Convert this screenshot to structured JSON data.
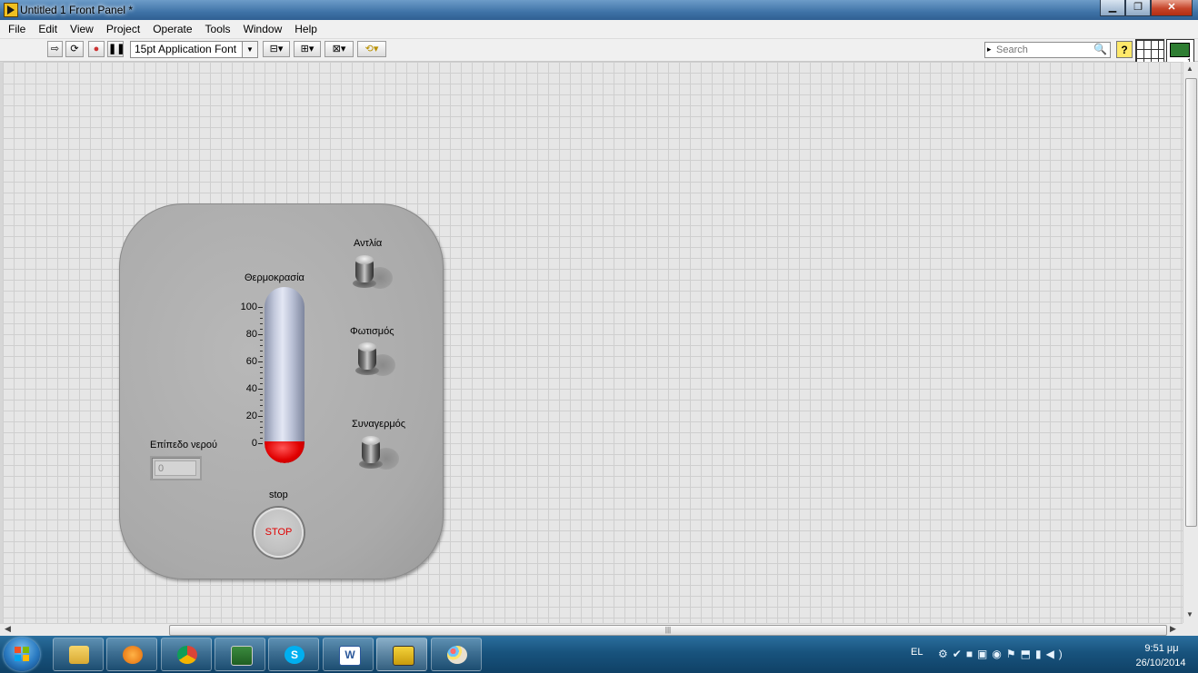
{
  "window": {
    "title": "Untitled 1 Front Panel *",
    "minimize_icon": "minimize-icon",
    "maximize_icon": "restore-icon",
    "close_icon": "close-icon"
  },
  "menu": [
    "File",
    "Edit",
    "View",
    "Project",
    "Operate",
    "Tools",
    "Window",
    "Help"
  ],
  "toolbar": {
    "font_select": "15pt Application Font",
    "search_placeholder": "Search",
    "help_label": "?",
    "vi_icon_number": "1"
  },
  "front_panel": {
    "thermometer": {
      "label": "Θερμοκρασία",
      "scale": [
        "100",
        "80",
        "60",
        "40",
        "20",
        "0"
      ],
      "value": 0
    },
    "switches": [
      {
        "label": "Αντλία",
        "state": "off"
      },
      {
        "label": "Φωτισμός",
        "state": "off"
      },
      {
        "label": "Συναγερμός",
        "state": "off"
      }
    ],
    "water_level": {
      "label": "Επίπεδο νερού",
      "value": "0"
    },
    "stop": {
      "label": "stop",
      "button_text": "STOP"
    }
  },
  "taskbar": {
    "apps": [
      "explorer",
      "media-player",
      "chrome",
      "task-manager",
      "skype",
      "word",
      "labview",
      "paint"
    ],
    "language": "EL",
    "time": "9:51 μμ",
    "date": "26/10/2014"
  },
  "colors": {
    "canvas": "#e6e6e6",
    "panel": "#b0b0b0",
    "thermo_fill": "#e00000",
    "stop_text": "#e00000"
  }
}
